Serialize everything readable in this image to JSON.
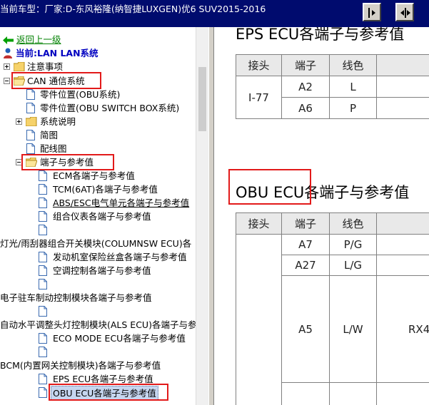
{
  "window": {
    "title": "当前车型：厂家:D-东风裕隆(纳智捷LUXGEN)优6 SUV2015-2016"
  },
  "toolbar": {
    "buttons": [
      "tile-vertical",
      "tile-horizontal"
    ]
  },
  "tree": {
    "back": "返回上一级",
    "current": "当前:LAN LAN系统",
    "items": [
      "注意事项",
      "CAN 通信系统",
      "零件位置(OBU系统)",
      "零件位置(OBU SWITCH BOX系统)",
      "系统说明",
      "简图",
      "配线图",
      "端子与参考值",
      "ECM各端子与参考值",
      "TCM(6AT)各端子与参考值",
      "ABS/ESC电气单元各端子与参考值",
      "组合仪表各端子与参考值",
      "",
      "灯光/雨刮器组合开关模块(COLUMNSW ECU)各",
      "发动机室保险丝盒各端子与参考值",
      "空调控制各端子与参考值",
      "",
      "电子驻车制动控制模块各端子与参考值",
      "",
      "自动水平调整头灯控制模块(ALS ECU)各端子与参考值",
      "ECO MODE ECU各端子与参考值",
      "",
      "BCM(内置网关控制模块)各端子与参考值",
      "EPS ECU各端子与参考值",
      "OBU ECU各端子与参考值"
    ]
  },
  "content": {
    "section1": {
      "title": "EPS ECU各端子与参考值",
      "headers": [
        "接头",
        "端子",
        "线色"
      ],
      "connector": "I-77",
      "rows": [
        {
          "terminal": "A2",
          "color": "L"
        },
        {
          "terminal": "A6",
          "color": "P"
        }
      ]
    },
    "section2": {
      "title_part1": "OBU ECU",
      "title_part2": "各端子与参考值",
      "headers": [
        "接头",
        "端子",
        "线色"
      ],
      "rows": [
        {
          "terminal": "A7",
          "color": "P/G",
          "extra": ""
        },
        {
          "terminal": "A27",
          "color": "L/G",
          "extra": ""
        },
        {
          "terminal": "A5",
          "color": "L/W",
          "extra": "RX4"
        }
      ]
    }
  },
  "colors": {
    "titlebar": "#000b6e",
    "highlight_box": "#e21a1a",
    "back_link": "#008000",
    "current": "#0000c0"
  }
}
